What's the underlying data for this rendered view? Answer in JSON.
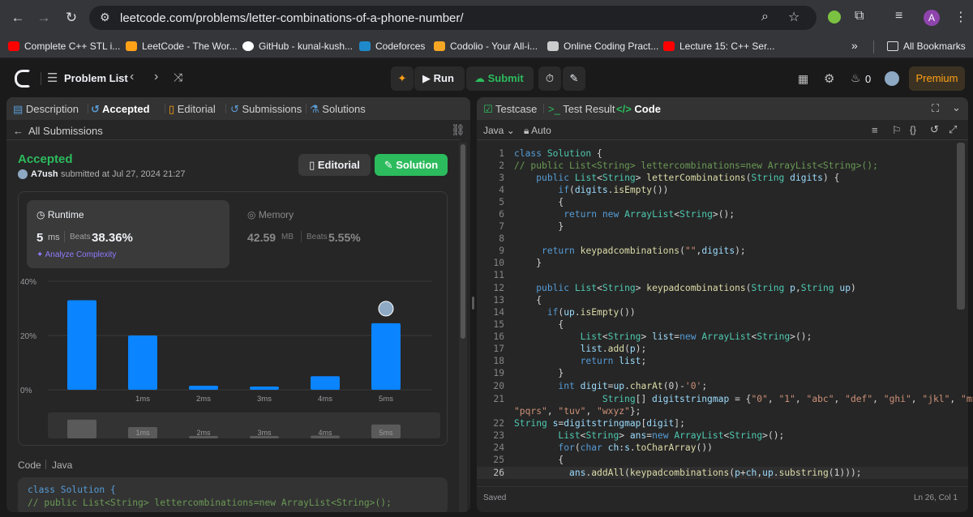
{
  "browser": {
    "url": "leetcode.com/problems/letter-combinations-of-a-phone-number/",
    "profile_initial": "A",
    "bookmarks": [
      {
        "label": "Complete C++ STL i...",
        "color": "#ff0000"
      },
      {
        "label": "LeetCode - The Wor...",
        "color": "#ffa116"
      },
      {
        "label": "GitHub - kunal-kush...",
        "color": "#ffffff"
      },
      {
        "label": "Codeforces",
        "color": "#1f8acb"
      },
      {
        "label": "Codolio - Your All-i...",
        "color": "#f5a623"
      },
      {
        "label": "Online Coding Pract...",
        "color": "#cccccc"
      },
      {
        "label": "Lecture 15: C++ Ser...",
        "color": "#ff0000"
      }
    ],
    "more_label": "»",
    "all_bookmarks": "All Bookmarks"
  },
  "header": {
    "problem_list": "Problem List",
    "run": "Run",
    "submit": "Submit",
    "streak": "0",
    "premium": "Premium"
  },
  "left": {
    "tabs": [
      "Description",
      "Accepted",
      "Editorial",
      "Submissions",
      "Solutions"
    ],
    "back": "All Submissions",
    "status": "Accepted",
    "user": "A7ush",
    "submitted": "submitted at Jul 27, 2024 21:27",
    "editorial_btn": "Editorial",
    "solution_btn": "Solution",
    "runtime": {
      "label": "Runtime",
      "value": "5",
      "unit": "ms",
      "beats_label": "Beats",
      "beats": "38.36%",
      "analyze": "Analyze Complexity"
    },
    "memory": {
      "label": "Memory",
      "value": "42.59",
      "unit": "MB",
      "beats_label": "Beats",
      "beats": "5.55%"
    },
    "code_label": "Code",
    "code_lang": "Java",
    "code_line1": "class Solution {",
    "code_line2": "// public List<String> lettercombinations=new ArrayList<String>();"
  },
  "chart_data": {
    "type": "bar",
    "categories": [
      "",
      "1ms",
      "2ms",
      "3ms",
      "4ms",
      "5ms"
    ],
    "values": [
      33,
      20,
      1.5,
      1.2,
      5,
      24.5
    ],
    "yticks": [
      "40%",
      "20%",
      "0%"
    ],
    "ylim": [
      0,
      40
    ],
    "highlight_category": "5ms",
    "colors": {
      "bar": "#0a84ff"
    }
  },
  "right": {
    "tabs": [
      "Testcase",
      "Test Result",
      "Code"
    ],
    "lang": "Java",
    "mode": "Auto",
    "status": "Saved",
    "cursor": "Ln 26, Col 1",
    "line_numbers": [
      "1",
      "2",
      "3",
      "4",
      "5",
      "6",
      "7",
      "8",
      "9",
      "10",
      "11",
      "12",
      "13",
      "14",
      "15",
      "16",
      "17",
      "18",
      "19",
      "20",
      "21",
      "",
      "22",
      "23",
      "24",
      "25",
      "26"
    ]
  }
}
